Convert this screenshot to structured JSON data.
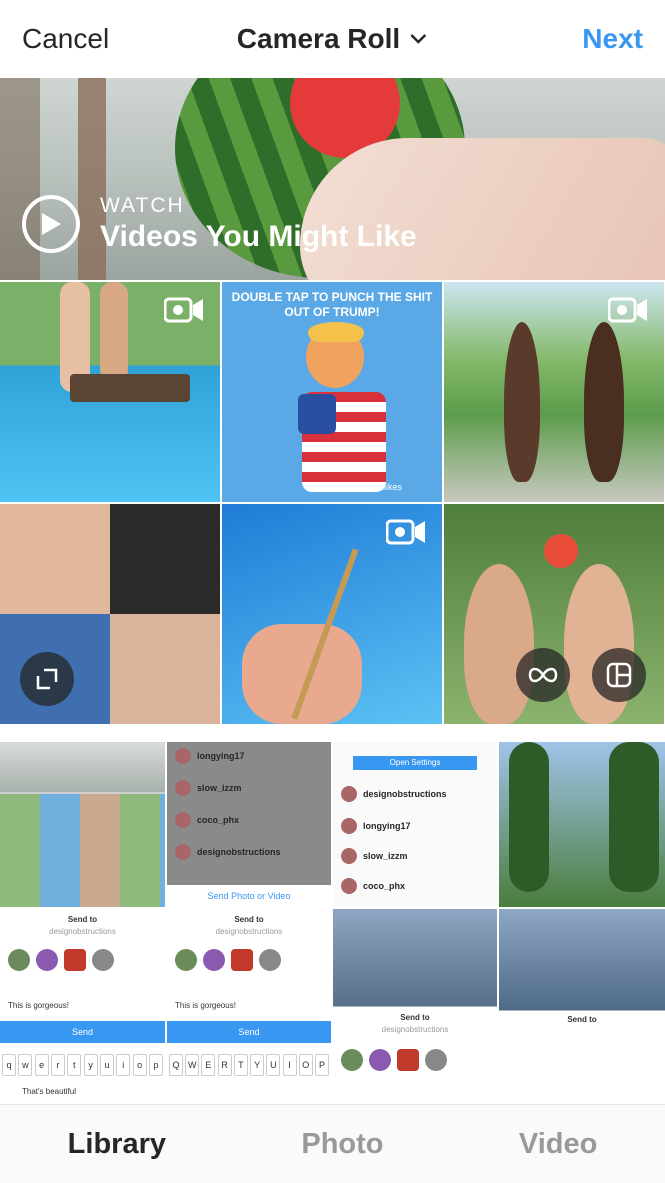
{
  "header": {
    "cancel_label": "Cancel",
    "title": "Camera Roll",
    "next_label": "Next"
  },
  "preview": {
    "kicker": "WATCH",
    "headline": "Videos You Might Like"
  },
  "grid": {
    "tile2_text": "DOUBLE TAP TO PUNCH THE SHIT OUT OF TRUMP!",
    "tile2_credit": "@post.likes"
  },
  "strip": {
    "b_users": [
      "longying17",
      "slow_izzm",
      "coco_phx",
      "designobstructions"
    ],
    "b_button": "Send Photo or Video",
    "c_button": "Open Settings",
    "c_users": [
      "designobstructions",
      "longying17",
      "slow_izzm",
      "coco_phx"
    ],
    "send_to": "Send to",
    "send_sub": "designobstructions",
    "comment": "This is gorgeous!",
    "send_label": "Send",
    "kbd_lower": [
      "q",
      "w",
      "e",
      "r",
      "t",
      "y",
      "u",
      "i",
      "o",
      "p"
    ],
    "kbd_upper": [
      "Q",
      "W",
      "E",
      "R",
      "T",
      "Y",
      "U",
      "I",
      "O",
      "P"
    ],
    "reply": "That's beautiful"
  },
  "tabs": {
    "library": "Library",
    "photo": "Photo",
    "video": "Video"
  },
  "colors": {
    "accent": "#3897f0",
    "text": "#262626",
    "inactive": "#999999"
  }
}
